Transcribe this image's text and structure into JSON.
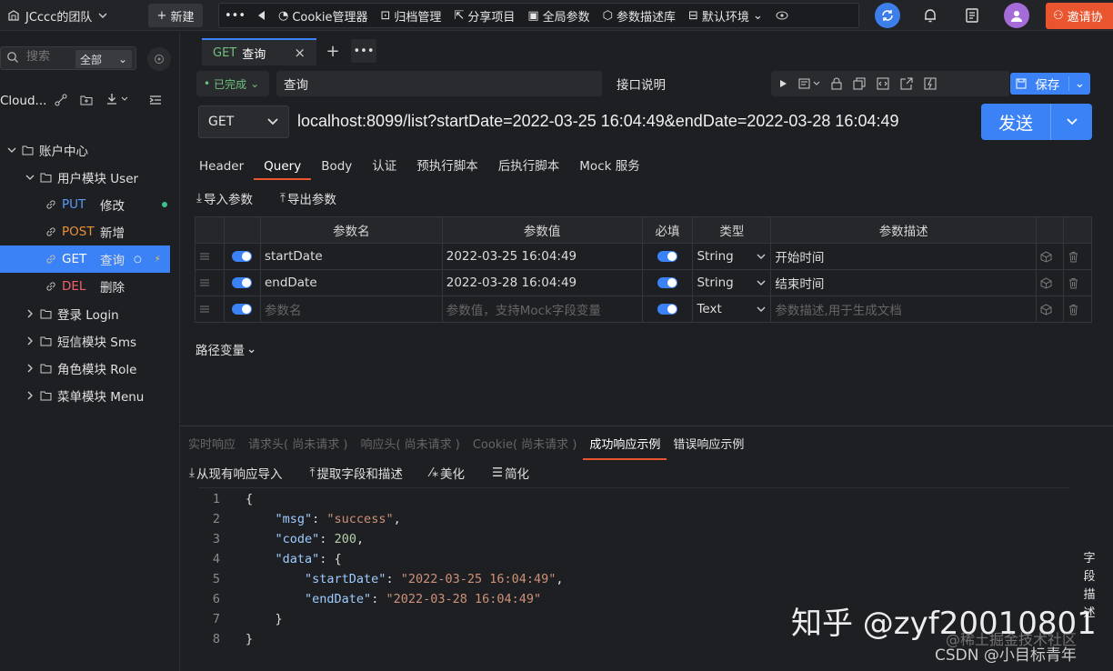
{
  "topbar": {
    "team": "JCccc的团队",
    "new_label": "新建",
    "tools": [
      "Cookie管理器",
      "归档管理",
      "分享项目",
      "全局参数",
      "参数描述库",
      "默认环境"
    ],
    "invite": "邀请协"
  },
  "sidebar": {
    "search_placeholder": "搜索",
    "filter": "全部",
    "project": "Cloud...",
    "tree": [
      {
        "label": "账户中心",
        "indent": 0,
        "type": "folder"
      },
      {
        "label": "用户模块 User",
        "indent": 1,
        "type": "folder"
      },
      {
        "method": "PUT",
        "label": "修改",
        "indent": 2,
        "type": "api",
        "method_color": "#5b9bf5"
      },
      {
        "method": "POST",
        "label": "新增",
        "indent": 2,
        "type": "api",
        "method_color": "#e8923a"
      },
      {
        "method": "GET",
        "label": "查询",
        "indent": 2,
        "type": "api",
        "method_color": "#ffffff"
      },
      {
        "method": "DEL",
        "label": "删除",
        "indent": 2,
        "type": "api",
        "method_color": "#f0616b"
      },
      {
        "label": "登录 Login",
        "indent": 1,
        "type": "folder"
      },
      {
        "label": "短信模块 Sms",
        "indent": 1,
        "type": "folder"
      },
      {
        "label": "角色模块 Role",
        "indent": 1,
        "type": "folder"
      },
      {
        "label": "菜单模块 Menu",
        "indent": 1,
        "type": "folder"
      }
    ]
  },
  "tab": {
    "method": "GET",
    "name": "查询"
  },
  "request": {
    "status": "已完成",
    "name": "查询",
    "desc_label": "接口说明",
    "save": "保存",
    "method": "GET",
    "url": "localhost:8099/list?startDate=2022-03-25 16:04:49&endDate=2022-03-28 16:04:49",
    "send": "发送"
  },
  "subtabs": [
    "Header",
    "Query",
    "Body",
    "认证",
    "预执行脚本",
    "后执行脚本",
    "Mock 服务"
  ],
  "import_label": "导入参数",
  "export_label": "导出参数",
  "params": {
    "headers": [
      "参数名",
      "参数值",
      "必填",
      "类型",
      "参数描述"
    ],
    "rows": [
      {
        "name": "startDate",
        "value": "2022-03-25 16:04:49",
        "type": "String",
        "desc": "开始时间"
      },
      {
        "name": "endDate",
        "value": "2022-03-28 16:04:49",
        "type": "String",
        "desc": "结束时间"
      }
    ],
    "placeholder": {
      "name": "参数名",
      "value": "参数值，支持Mock字段变量",
      "type": "Text",
      "desc": "参数描述,用于生成文档"
    }
  },
  "path_var": "路径变量",
  "response": {
    "tabs": [
      "实时响应",
      "请求头( 尚未请求 )",
      "响应头( 尚未请求 )",
      "Cookie( 尚未请求 )",
      "成功响应示例",
      "错误响应示例"
    ],
    "tools": [
      "从现有响应导入",
      "提取字段和描述",
      "美化",
      "简化"
    ],
    "field_desc": "字段描述"
  },
  "code": {
    "msg_key": "\"msg\"",
    "msg_val": "\"success\"",
    "code_key": "\"code\"",
    "code_val": "200",
    "data_key": "\"data\"",
    "start_key": "\"startDate\"",
    "start_val": "\"2022-03-25 16:04:49\"",
    "end_key": "\"endDate\"",
    "end_val": "\"2022-03-28 16:04:49\""
  },
  "watermark": {
    "zhihu": "知乎 @zyf20010801",
    "juejin": "@稀土掘金技术社区",
    "csdn": "CSDN @小目标青年"
  }
}
